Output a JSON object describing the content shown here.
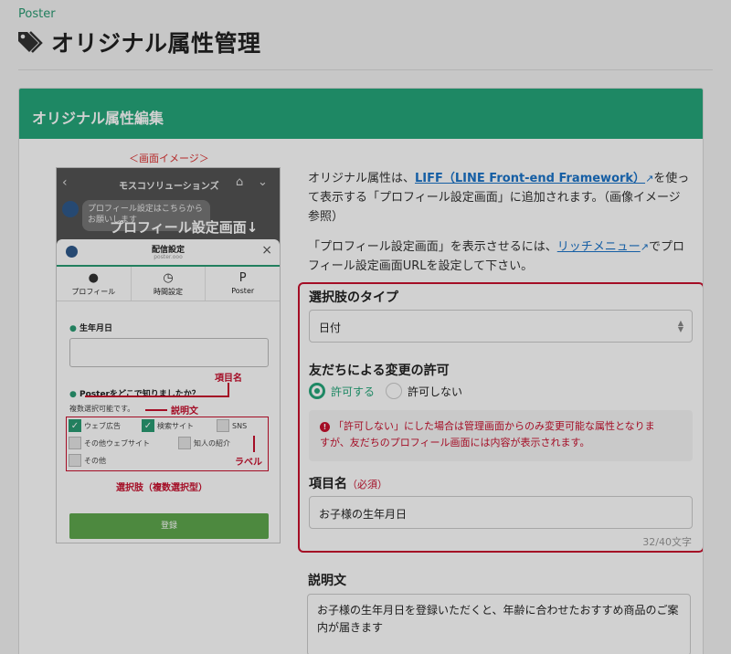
{
  "header": {
    "app_label": "Poster",
    "page_title": "オリジナル属性管理"
  },
  "card": {
    "title": "オリジナル属性編集"
  },
  "preview": {
    "caption": "＜画面イメージ＞",
    "top_bar_title": "モスコソリューションズ",
    "bubble_text": "プロフィール設定はこちらから お願いします",
    "overlay_text": "プロフィール設定画面↓",
    "sheet_title": "配信設定",
    "sheet_subtitle": "poster.ooo",
    "tabs": [
      "プロフィール",
      "時間設定",
      "Poster"
    ],
    "field_birthday": "生年月日",
    "field_question": "Posterをどこで知りましたか？",
    "field_desc": "複数選択可能です。",
    "options": [
      "ウェブ広告",
      "検索サイト",
      "SNS",
      "その他ウェブサイト",
      "知人の紹介",
      "その他"
    ],
    "register_button": "登録",
    "annotations": {
      "item_name": "項目名",
      "description": "説明文",
      "label": "ラベル",
      "choices": "選択肢（複数選択型）"
    }
  },
  "intro": {
    "p1_before": "オリジナル属性は、",
    "p1_link": "LIFF（LINE Front-end Framework）",
    "p1_after": "を使って表示する「プロフィール設定画面」に追加されます。（画像イメージ参照）",
    "p2_before": "「プロフィール設定画面」を表示させるには、",
    "p2_link": "リッチメニュー",
    "p2_after": "でプロフィール設定画面URLを設定して下さい。"
  },
  "form": {
    "choice_type_label": "選択肢のタイプ",
    "choice_type_value": "日付",
    "permission_label": "友だちによる変更の許可",
    "radio_allow": "許可する",
    "radio_deny": "許可しない",
    "notice_line1": "「許可しない」にした場合は管理画面からのみ変更可能な属性となりま",
    "notice_line2": "すが、友だちのプロフィール画面には内容が表示されます。",
    "item_name_label": "項目名",
    "required_label": "（必須）",
    "item_name_value": "お子様の生年月日",
    "counter": "32/40文字",
    "description_label": "説明文",
    "description_value": "お子様の生年月日を登録いただくと、年齢に合わせたおすすめ商品のご案内が届きます"
  }
}
